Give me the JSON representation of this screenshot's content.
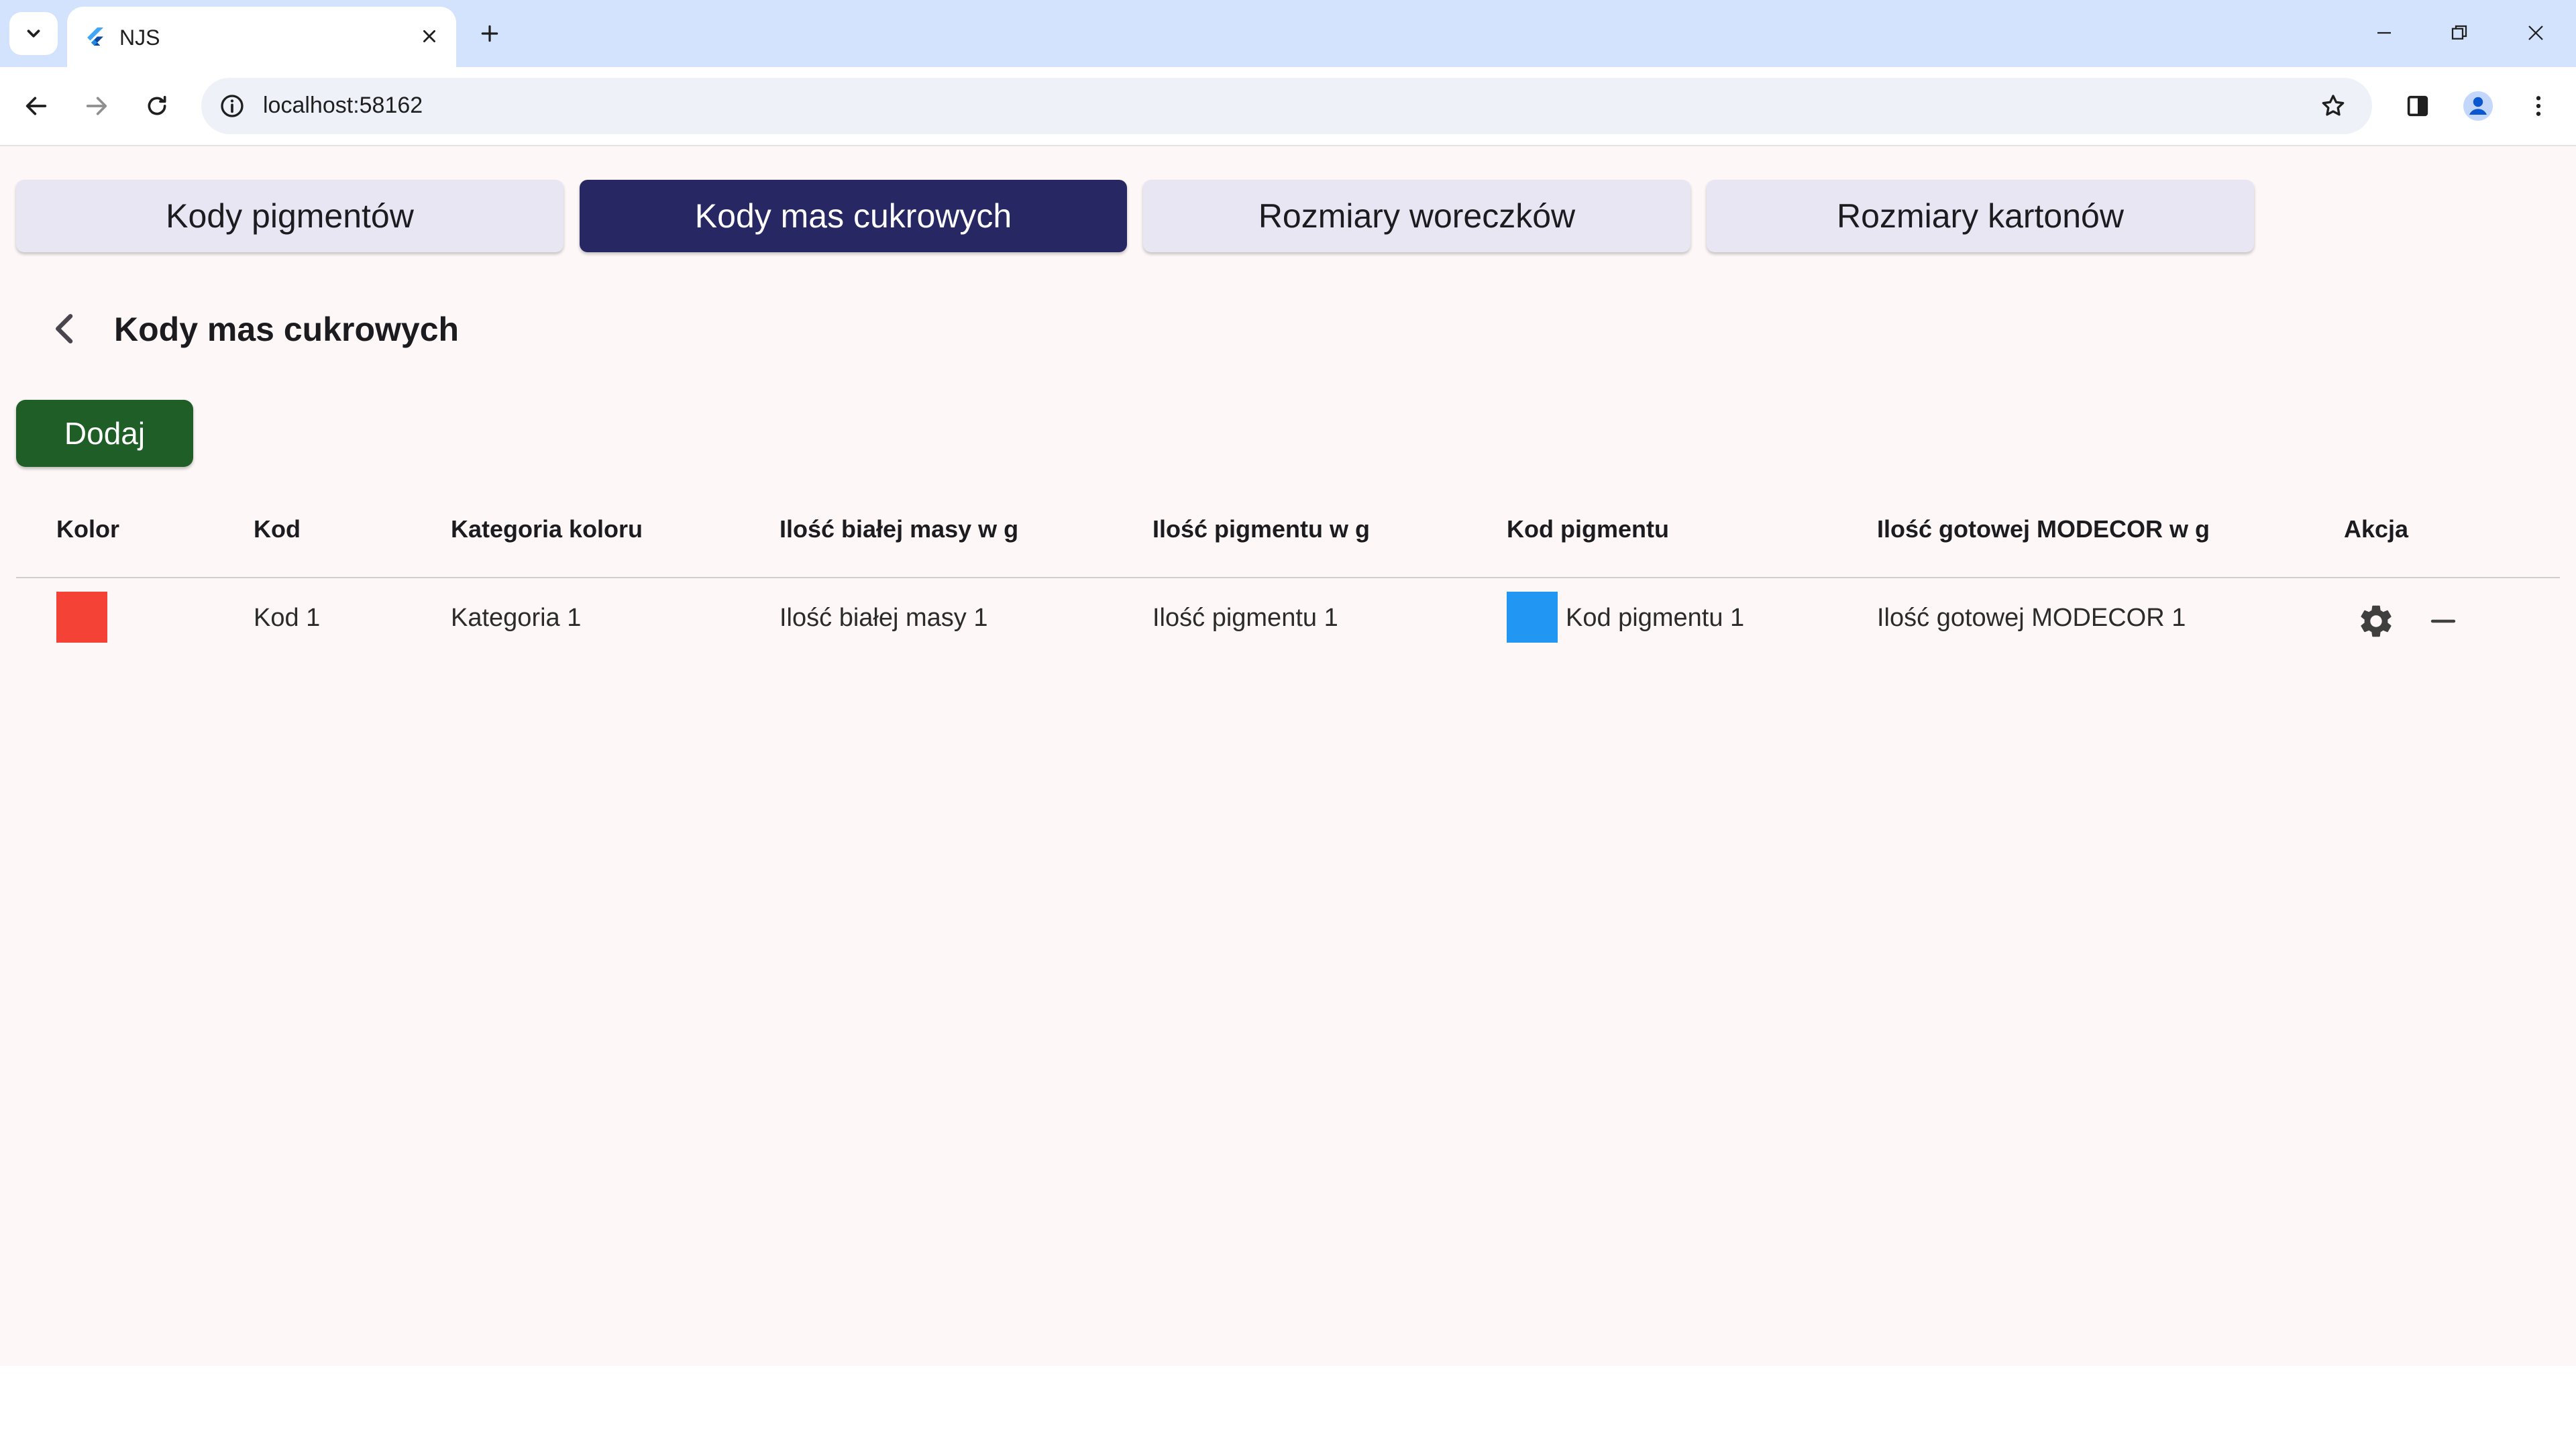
{
  "browser": {
    "tab_title": "NJS",
    "url": "localhost:58162",
    "icons": {
      "tab_search": "chevron-down-icon",
      "favicon": "flutter-icon",
      "close_tab": "close-icon",
      "new_tab": "plus-icon",
      "back": "arrow-left-icon",
      "forward": "arrow-right-icon",
      "reload": "reload-icon",
      "site_info": "info-icon",
      "bookmark": "star-icon",
      "side_panel": "side-panel-icon",
      "profile": "profile-icon",
      "menu": "kebab-menu-icon"
    }
  },
  "nav": {
    "buttons": [
      {
        "label": "Kody pigmentów",
        "active": false
      },
      {
        "label": "Kody mas cukrowych",
        "active": true
      },
      {
        "label": "Rozmiary woreczków",
        "active": false
      },
      {
        "label": "Rozmiary kartonów",
        "active": false
      }
    ]
  },
  "header": {
    "title": "Kody mas cukrowych"
  },
  "actions": {
    "add_label": "Dodaj"
  },
  "table": {
    "headers": {
      "kolor": "Kolor",
      "kod": "Kod",
      "kategoria": "Kategoria koloru",
      "biala_masa": "Ilość białej masy w g",
      "pigment": "Ilość pigmentu w g",
      "kod_pigmentu": "Kod pigmentu",
      "modecor": "Ilość gotowej MODECOR w g",
      "akcja": "Akcja"
    },
    "rows": [
      {
        "kolor": "#f44336",
        "kod": "Kod 1",
        "kategoria": "Kategoria 1",
        "biala_masa": "Ilość białej masy 1",
        "pigment": "Ilość pigmentu 1",
        "pigment_color": "#2196f3",
        "kod_pigmentu": "Kod pigmentu 1",
        "modecor": "Ilość gotowej MODECOR 1"
      }
    ]
  },
  "colors": {
    "accent": "#272863",
    "add_button": "#1f5e27",
    "page_background": "#fdf8f7",
    "chrome_titlebar": "#d3e3fd"
  }
}
